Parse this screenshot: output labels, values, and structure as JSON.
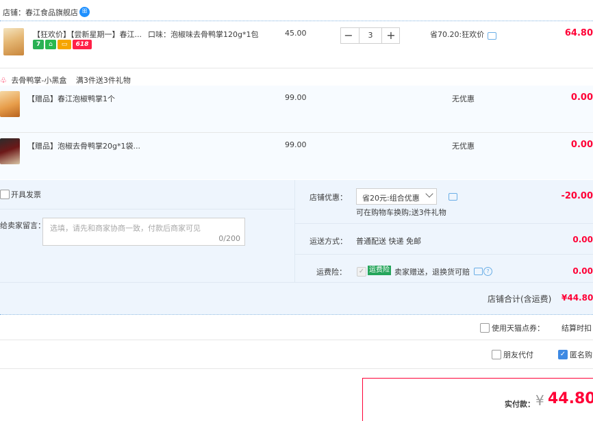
{
  "shop": {
    "label": "店铺：春江食品旗舰店",
    "ww_glyph": "ꕥ"
  },
  "items": [
    {
      "title": "【狂欢价】【尝新星期一】春江...",
      "sku": "口味：泡椒味去骨鸭掌120g*1包",
      "tags": [
        "7",
        "⌂",
        "▭",
        "618"
      ],
      "price": "45.00",
      "qty": "3",
      "minus": "−",
      "plus": "+",
      "promo": "省70.20:狂欢价",
      "sum": "64.80"
    }
  ],
  "gift_group": {
    "name": "去骨鸭掌-小黑盒",
    "rule": "满3件送3件礼物",
    "items": [
      {
        "title": "【赠品】春江泡椒鸭掌1个",
        "price": "99.00",
        "promo": "无优惠",
        "sum": "0.00"
      },
      {
        "title": "【赠品】泡椒去骨鸭掌20g*1袋...",
        "price": "99.00",
        "promo": "无优惠",
        "sum": "0.00"
      }
    ]
  },
  "invoice": {
    "label": "开具发票"
  },
  "message": {
    "label": "给卖家留言：",
    "placeholder": "选填，请先和商家协商一致，付款后商家可见",
    "counter": "0/200"
  },
  "shop_discount": {
    "label": "店铺优惠：",
    "selected": "省20元:组合优惠",
    "note": "可在购物车换购;送3件礼物",
    "amount": "-20.00"
  },
  "shipping": {
    "label": "运送方式：",
    "value": "普通配送 快递 免邮",
    "amount": "0.00"
  },
  "insurance": {
    "label": "运费险：",
    "badge": "运费险",
    "text": "卖家赠送，退换货可赔",
    "amount": "0.00",
    "help": "?"
  },
  "shop_total": {
    "label": "店铺合计(含运费)",
    "value": "¥44.80"
  },
  "tmall_points": {
    "label": "使用天猫点券：",
    "note": "结算时扣"
  },
  "friend_pay": {
    "label": "朋友代付"
  },
  "anonymous": {
    "label": "匿名购",
    "check": "✓"
  },
  "actual_pay": {
    "label": "实付款：",
    "currency": "¥",
    "amount": "44.80"
  },
  "colors": {
    "accent": "#ff0036",
    "link_blue": "#3d89e3",
    "panel_bg": "#eef5fd",
    "badge_green": "#25a55b"
  }
}
